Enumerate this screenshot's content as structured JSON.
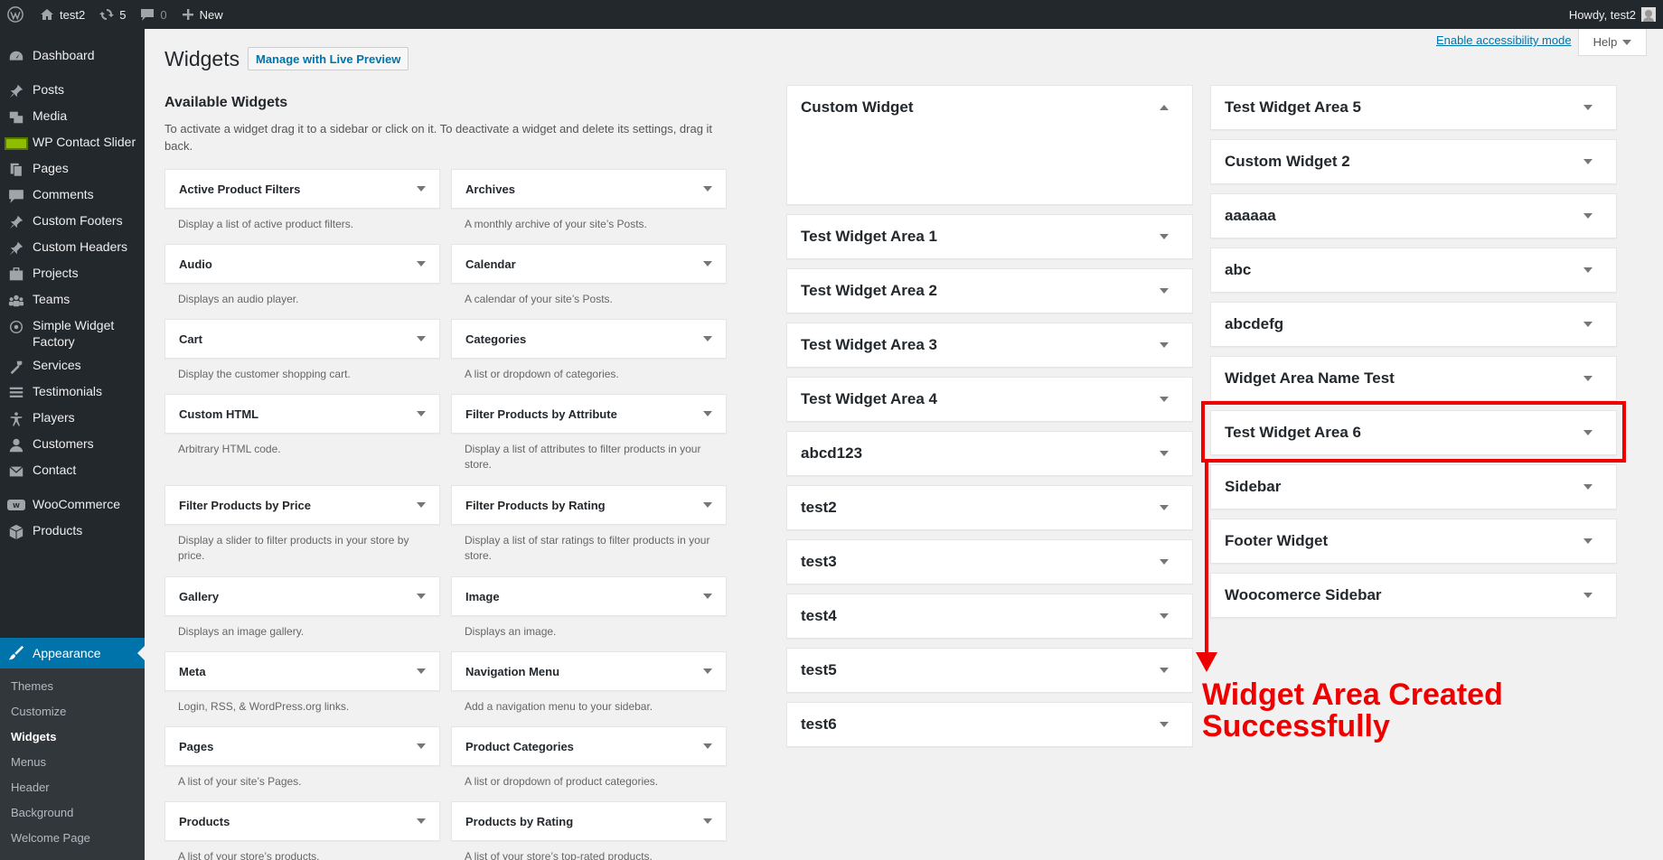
{
  "adminbar": {
    "site_name": "test2",
    "updates_count": "5",
    "comments_count": "0",
    "new_label": "New",
    "howdy": "Howdy, test2",
    "icons": [
      "wordpress-logo-icon",
      "home-icon",
      "updates-icon",
      "comment-icon",
      "plus-icon",
      "avatar"
    ]
  },
  "menu": {
    "dashboard": "Dashboard",
    "posts": "Posts",
    "media": "Media",
    "wp_contact_slider": "WP Contact Slider",
    "pages": "Pages",
    "comments": "Comments",
    "custom_footers": "Custom Footers",
    "custom_headers": "Custom Headers",
    "projects": "Projects",
    "teams": "Teams",
    "simple_widget_factory": "Simple Widget Factory",
    "services": "Services",
    "testimonials": "Testimonials",
    "players": "Players",
    "customers": "Customers",
    "contact": "Contact",
    "woocommerce": "WooCommerce",
    "products": "Products",
    "appearance": "Appearance",
    "submenu": [
      "Themes",
      "Customize",
      "Widgets",
      "Menus",
      "Header",
      "Background",
      "Welcome Page"
    ],
    "accent_color": "#0073aa"
  },
  "page": {
    "title": "Widgets",
    "live_preview_button": "Manage with Live Preview",
    "accessibility_link": "Enable accessibility mode",
    "help_tab": "Help"
  },
  "available": {
    "title": "Available Widgets",
    "description": "To activate a widget drag it to a sidebar or click on it. To deactivate a widget and delete its settings, drag it back.",
    "widgets": [
      {
        "name": "Active Product Filters",
        "desc": "Display a list of active product filters."
      },
      {
        "name": "Archives",
        "desc": "A monthly archive of your site’s Posts."
      },
      {
        "name": "Audio",
        "desc": "Displays an audio player."
      },
      {
        "name": "Calendar",
        "desc": "A calendar of your site’s Posts."
      },
      {
        "name": "Cart",
        "desc": "Display the customer shopping cart."
      },
      {
        "name": "Categories",
        "desc": "A list or dropdown of categories."
      },
      {
        "name": "Custom HTML",
        "desc": "Arbitrary HTML code."
      },
      {
        "name": "Filter Products by Attribute",
        "desc": "Display a list of attributes to filter products in your store."
      },
      {
        "name": "Filter Products by Price",
        "desc": "Display a slider to filter products in your store by price."
      },
      {
        "name": "Filter Products by Rating",
        "desc": "Display a list of star ratings to filter products in your store."
      },
      {
        "name": "Gallery",
        "desc": "Displays an image gallery."
      },
      {
        "name": "Image",
        "desc": "Displays an image."
      },
      {
        "name": "Meta",
        "desc": "Login, RSS, & WordPress.org links."
      },
      {
        "name": "Navigation Menu",
        "desc": "Add a navigation menu to your sidebar."
      },
      {
        "name": "Pages",
        "desc": "A list of your site’s Pages."
      },
      {
        "name": "Product Categories",
        "desc": "A list or dropdown of product categories."
      },
      {
        "name": "Products",
        "desc": "A list of your store’s products."
      },
      {
        "name": "Products by Rating",
        "desc": "A list of your store’s top-rated products."
      }
    ]
  },
  "areas_col1": [
    "Custom Widget",
    "Test Widget Area 1",
    "Test Widget Area 2",
    "Test Widget Area 3",
    "Test Widget Area 4",
    "abcd123",
    "test2",
    "test3",
    "test4",
    "test5",
    "test6"
  ],
  "areas_col2": [
    "Test Widget Area 5",
    "Custom Widget 2",
    "aaaaaa",
    "abc",
    "abcdefg",
    "Widget Area Name Test",
    "Test Widget Area 6",
    "Sidebar",
    "Footer Widget",
    "Woocomerce Sidebar"
  ],
  "annotation": {
    "text_line1": "Widget Area Created",
    "text_line2": "Successfully",
    "color": "#e00000"
  }
}
